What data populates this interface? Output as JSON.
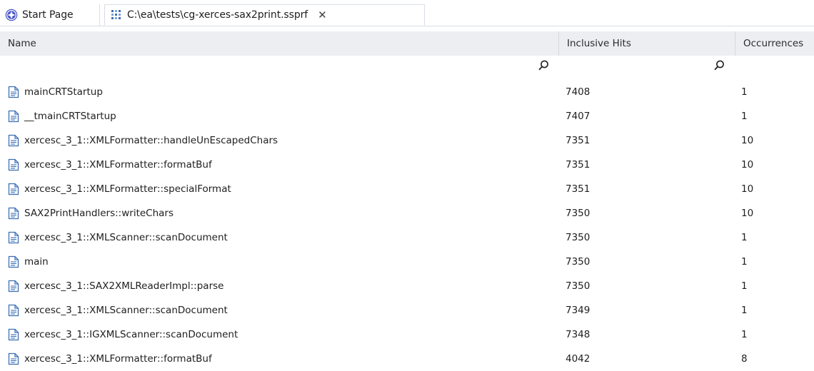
{
  "tabs": [
    {
      "label": "Start Page",
      "icon": "start-page-icon"
    },
    {
      "label": "C:\\ea\\tests\\cg-xerces-sax2print.ssprf",
      "icon": "profiler-icon",
      "close": "✕"
    }
  ],
  "columns": {
    "name": "Name",
    "inclusive_hits": "Inclusive Hits",
    "occurrences": "Occurrences"
  },
  "colors": {
    "accent": "#4a56c9",
    "header_bg": "#eceef1",
    "icon_blue": "#3c6fb4"
  },
  "rows": [
    {
      "name": "mainCRTStartup",
      "hits": "7408",
      "occurrences": "1"
    },
    {
      "name": "__tmainCRTStartup",
      "hits": "7407",
      "occurrences": "1"
    },
    {
      "name": "xercesc_3_1::XMLFormatter::handleUnEscapedChars",
      "hits": "7351",
      "occurrences": "10"
    },
    {
      "name": "xercesc_3_1::XMLFormatter::formatBuf",
      "hits": "7351",
      "occurrences": "10"
    },
    {
      "name": "xercesc_3_1::XMLFormatter::specialFormat",
      "hits": "7351",
      "occurrences": "10"
    },
    {
      "name": "SAX2PrintHandlers::writeChars",
      "hits": "7350",
      "occurrences": "10"
    },
    {
      "name": "xercesc_3_1::XMLScanner::scanDocument",
      "hits": "7350",
      "occurrences": "1"
    },
    {
      "name": "main",
      "hits": "7350",
      "occurrences": "1"
    },
    {
      "name": "xercesc_3_1::SAX2XMLReaderImpl::parse",
      "hits": "7350",
      "occurrences": "1"
    },
    {
      "name": "xercesc_3_1::XMLScanner::scanDocument",
      "hits": "7349",
      "occurrences": "1"
    },
    {
      "name": "xercesc_3_1::IGXMLScanner::scanDocument",
      "hits": "7348",
      "occurrences": "1"
    },
    {
      "name": "xercesc_3_1::XMLFormatter::formatBuf",
      "hits": "4042",
      "occurrences": "8"
    }
  ]
}
